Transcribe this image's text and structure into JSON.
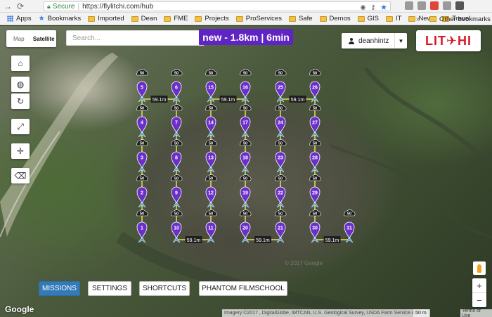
{
  "browser": {
    "secure_label": "Secure",
    "url": "https://flylitchi.com/hub",
    "bookmarks": [
      "Imported",
      "Dean",
      "FME",
      "Projects",
      "ProServices",
      "Safe",
      "Demos",
      "GIS",
      "IT",
      "News",
      "Travel"
    ],
    "apps_label": "Apps",
    "bookmarks_label": "Bookmarks",
    "more_label": "»",
    "other_bookmarks_label": "Other bookmarks"
  },
  "map": {
    "map_type_options": [
      "Map",
      "Satellite"
    ],
    "map_type_selected": "Satellite",
    "search_placeholder": "Search...",
    "mission_summary": "new - 1.8km | 6min",
    "user_name": "deanhintz",
    "logo_text": "LIT✈HI",
    "google_logo": "Google",
    "attribution": "Imagery ©2017 , DigitalGlobe, IMTCAN, U.S. Geological Survey, USDA Farm Service Agency",
    "scale_label": "50 m",
    "terms_label": "Terms of Use",
    "watermark": "© 2017 Google"
  },
  "toolbar": {
    "buttons": [
      "home-icon",
      "globe-icon",
      "refresh-icon",
      "expand-icon",
      "crosshair-icon",
      "eraser-icon"
    ]
  },
  "bottom_bar": {
    "missions_label": "MISSIONS",
    "settings_label": "SETTINGS",
    "shortcuts_label": "SHORTCUTS",
    "filmschool_label": "PHANTOM FILMSCHOOL"
  },
  "mission": {
    "altitude_label": "50",
    "segment_label": "59.1m",
    "waypoint_color": "#6a2fc9",
    "path_color": "#e3e05a",
    "waypoints": [
      {
        "n": "1",
        "col": 0,
        "row": 4
      },
      {
        "n": "2",
        "col": 0,
        "row": 3
      },
      {
        "n": "3",
        "col": 0,
        "row": 2
      },
      {
        "n": "4",
        "col": 0,
        "row": 1
      },
      {
        "n": "5",
        "col": 0,
        "row": 0
      },
      {
        "n": "6",
        "col": 1,
        "row": 0
      },
      {
        "n": "7",
        "col": 1,
        "row": 1
      },
      {
        "n": "8",
        "col": 1,
        "row": 2
      },
      {
        "n": "9",
        "col": 1,
        "row": 3
      },
      {
        "n": "10",
        "col": 1,
        "row": 4
      },
      {
        "n": "11",
        "col": 2,
        "row": 4
      },
      {
        "n": "12",
        "col": 2,
        "row": 3
      },
      {
        "n": "13",
        "col": 2,
        "row": 2
      },
      {
        "n": "14",
        "col": 2,
        "row": 1
      },
      {
        "n": "15",
        "col": 2,
        "row": 0
      },
      {
        "n": "16",
        "col": 3,
        "row": 0
      },
      {
        "n": "17",
        "col": 3,
        "row": 1
      },
      {
        "n": "18",
        "col": 3,
        "row": 2
      },
      {
        "n": "19",
        "col": 3,
        "row": 3
      },
      {
        "n": "20",
        "col": 3,
        "row": 4
      },
      {
        "n": "21",
        "col": 4,
        "row": 4
      },
      {
        "n": "22",
        "col": 4,
        "row": 3
      },
      {
        "n": "23",
        "col": 4,
        "row": 2
      },
      {
        "n": "24",
        "col": 4,
        "row": 1
      },
      {
        "n": "25",
        "col": 4,
        "row": 0
      },
      {
        "n": "26",
        "col": 5,
        "row": 0
      },
      {
        "n": "27",
        "col": 5,
        "row": 1
      },
      {
        "n": "28",
        "col": 5,
        "row": 2
      },
      {
        "n": "29",
        "col": 5,
        "row": 3
      },
      {
        "n": "30",
        "col": 5,
        "row": 4
      },
      {
        "n": "31",
        "col": 6,
        "row": 4
      }
    ]
  }
}
